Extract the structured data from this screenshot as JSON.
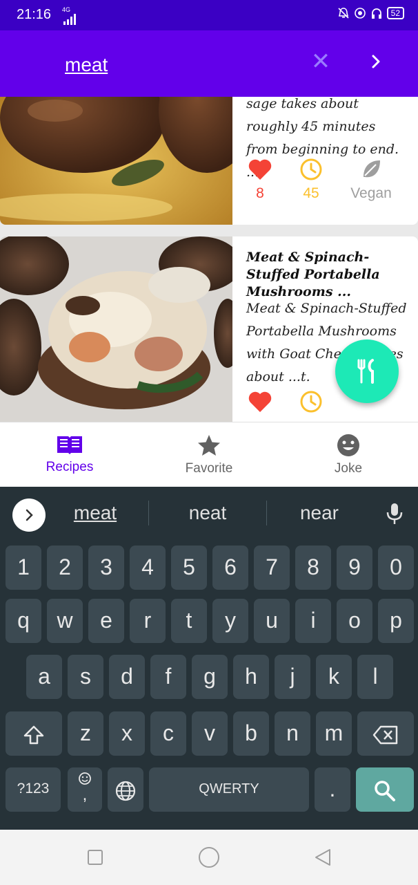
{
  "status_bar": {
    "time": "21:16",
    "network": "4G",
    "battery": "52"
  },
  "app_bar": {
    "search_query": "meat"
  },
  "recipes": [
    {
      "description": "sage takes about roughly 45 minutes from beginning to end. ...",
      "likes": "8",
      "minutes": "45",
      "diet": "Vegan"
    },
    {
      "title": "Meat & Spinach-Stuffed Portabella Mushrooms ...",
      "description": "Meat & Spinach-Stuffed Portabella Mushrooms with Goat Cheese takes about ...t."
    }
  ],
  "bottom_nav": {
    "items": [
      {
        "label": "Recipes",
        "icon": "book-icon",
        "active": true
      },
      {
        "label": "Favorite",
        "icon": "star-icon",
        "active": false
      },
      {
        "label": "Joke",
        "icon": "smile-icon",
        "active": false
      }
    ]
  },
  "keyboard": {
    "suggestions": [
      "meat",
      "neat",
      "near"
    ],
    "row_numbers": [
      "1",
      "2",
      "3",
      "4",
      "5",
      "6",
      "7",
      "8",
      "9",
      "0"
    ],
    "row_top": [
      "q",
      "w",
      "e",
      "r",
      "t",
      "y",
      "u",
      "i",
      "o",
      "p"
    ],
    "row_home": [
      "a",
      "s",
      "d",
      "f",
      "g",
      "h",
      "j",
      "k",
      "l"
    ],
    "row_bottom": [
      "z",
      "x",
      "c",
      "v",
      "b",
      "n",
      "m"
    ],
    "symbols_label": "?123",
    "comma": ",",
    "space_label": "QWERTY",
    "period": "."
  },
  "colors": {
    "status_bar": "#3b00c4",
    "app_bar": "#6200ea",
    "fab": "#1de9b6",
    "heart": "#f44336",
    "clock": "#fbc02d",
    "keyboard_bg": "#263238",
    "key_bg": "#3c4a52",
    "search_key": "#5fa8a0"
  }
}
